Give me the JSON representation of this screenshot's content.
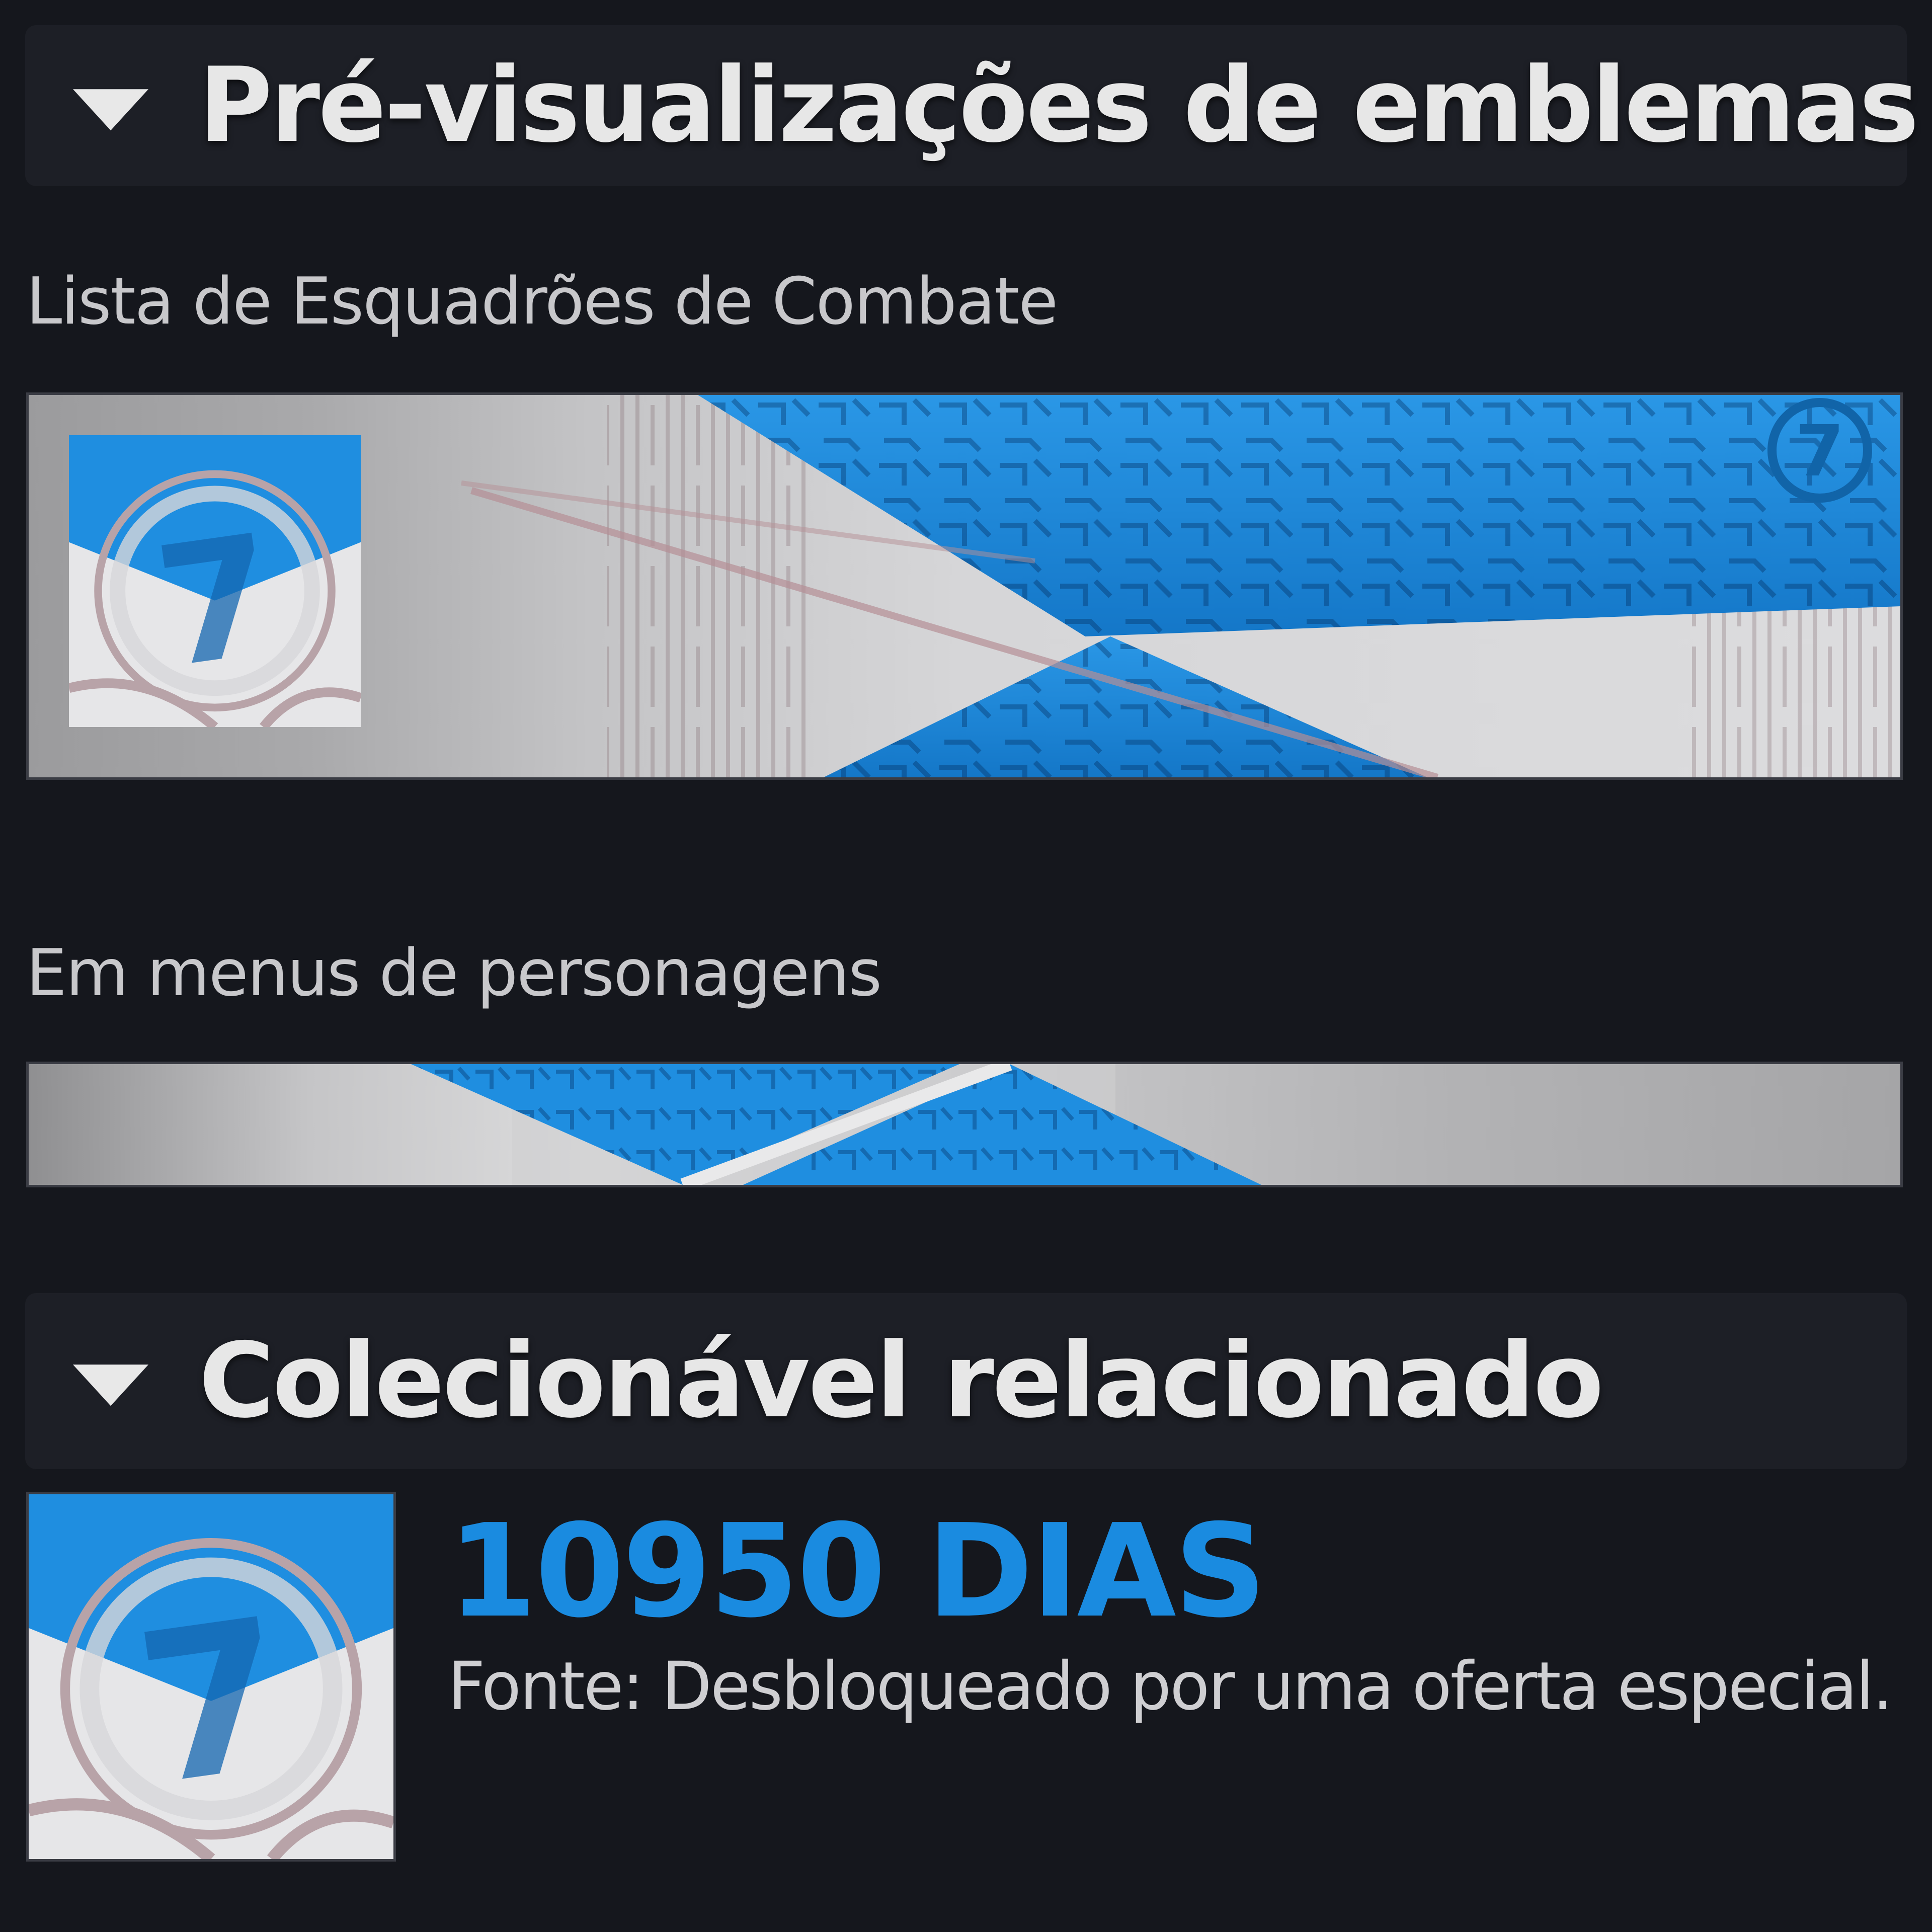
{
  "sections": {
    "previews": {
      "title": "Pré-visualizações de emblemas"
    },
    "related": {
      "title": "Colecionável relacionado"
    }
  },
  "previews": {
    "squad_label": "Lista de Esquadrões de Combate",
    "menu_label": "Em menus de personagens"
  },
  "collectible": {
    "name": "10950 DIAS",
    "source": "Fonte: Desbloqueado por uma oferta especial."
  },
  "colors": {
    "background": "#15171d",
    "header": "#1d1f26",
    "accent_blue": "#1a8be0",
    "emblem_blue": "#1f8ee0",
    "emblem_silver": "#c9c9cb"
  },
  "icons": {
    "collapse": "caret-down-icon",
    "emblem": "emblem-seven-icon"
  }
}
